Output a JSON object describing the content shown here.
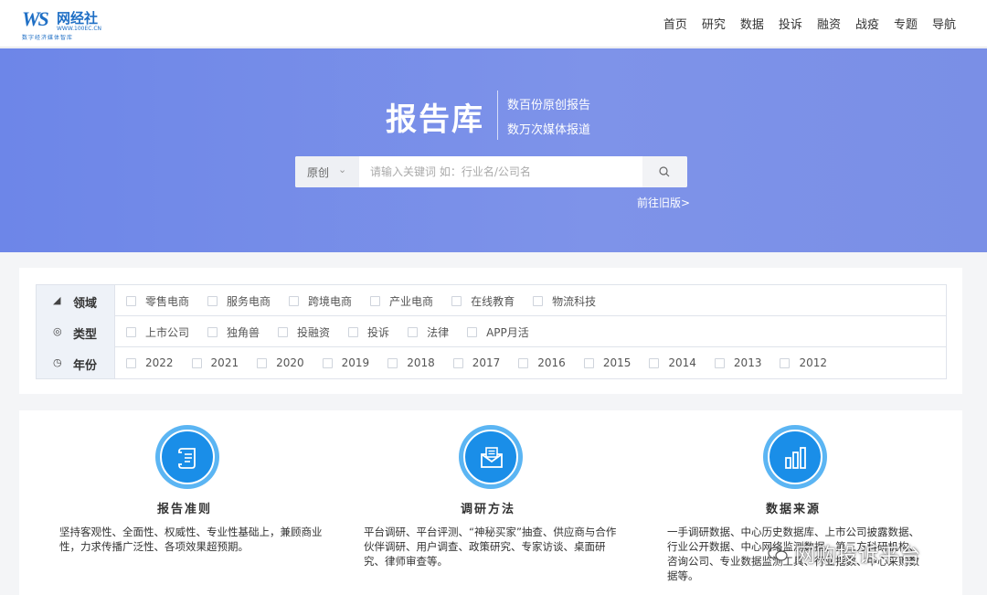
{
  "header": {
    "logo_mark": "WS",
    "logo_name": "网经社",
    "logo_url": "WWW.100EC.CN",
    "logo_slogan": "数字经济媒体智库",
    "nav": [
      "首页",
      "研究",
      "数据",
      "投诉",
      "融资",
      "战疫",
      "专题",
      "导航"
    ]
  },
  "banner": {
    "title": "报告库",
    "subtitle_1": "数百份原创报告",
    "subtitle_2": "数万次媒体报道",
    "search_type": "原创",
    "search_placeholder": "请输入关键词 如：行业名/公司名",
    "old_version_link": "前往旧版>"
  },
  "filters": [
    {
      "icon": "domain-icon",
      "label": "领域",
      "options": [
        "零售电商",
        "服务电商",
        "跨境电商",
        "产业电商",
        "在线教育",
        "物流科技"
      ]
    },
    {
      "icon": "type-icon",
      "label": "类型",
      "options": [
        "上市公司",
        "独角兽",
        "投融资",
        "投诉",
        "法律",
        "APP月活"
      ]
    },
    {
      "icon": "clock-icon",
      "label": "年份",
      "options": [
        "2022",
        "2021",
        "2020",
        "2019",
        "2018",
        "2017",
        "2016",
        "2015",
        "2014",
        "2013",
        "2012"
      ]
    }
  ],
  "cards": [
    {
      "icon": "scroll-icon",
      "title": "报告准则",
      "desc": "坚持客观性、全面性、权威性、专业性基础上，兼顾商业性，力求传播广泛性、各项效果超预期。"
    },
    {
      "icon": "envelope-icon",
      "title": "调研方法",
      "desc": "平台调研、平台评测、“神秘买家”抽查、供应商与合作伙伴调研、用户调查、政策研究、专家访谈、桌面研究、律师审查等。"
    },
    {
      "icon": "bar-chart-icon",
      "title": "数据来源",
      "desc": "一手调研数据、中心历史数据库、上市公司披露数据、行业公开数据、中心网络监测数据、第三方科研机构、咨询公司、专业数据监测工具、行业指数、中心采购数据等。"
    }
  ],
  "watermark": "网购投诉平台",
  "colors": {
    "accent": "#1a8ee8",
    "banner": "#7a8fe6",
    "logo": "#1f6fc5"
  }
}
